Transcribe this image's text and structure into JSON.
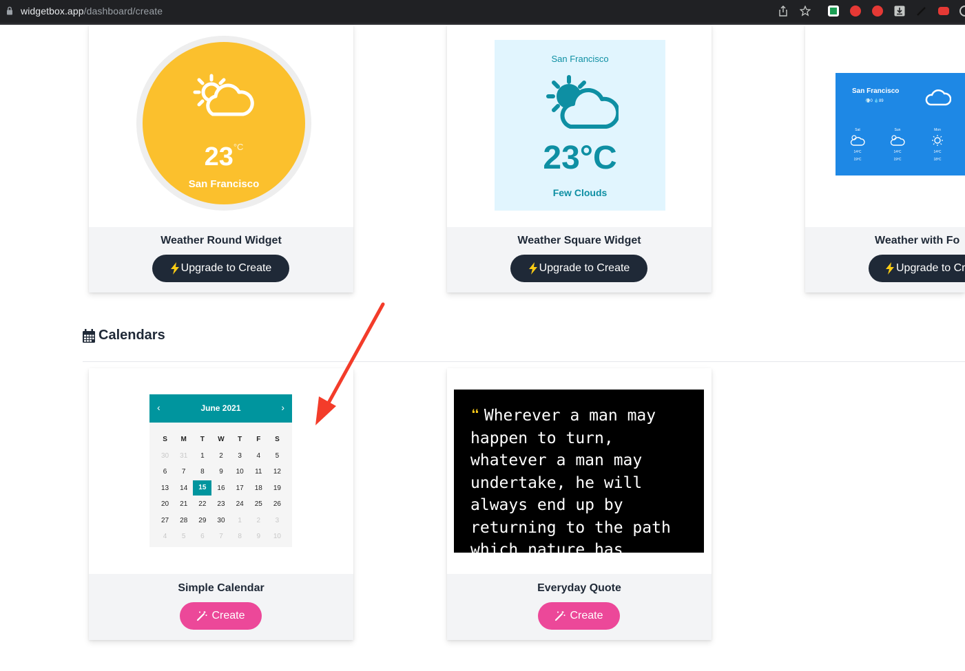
{
  "browser": {
    "url_host": "widgetbox.app",
    "url_path": "/dashboard/create"
  },
  "widgets_weather": [
    {
      "title": "Weather Round Widget",
      "button": "Upgrade to Create",
      "preview": {
        "temp": "23",
        "unit": "°C",
        "city": "San Francisco"
      }
    },
    {
      "title": "Weather Square Widget",
      "button": "Upgrade to Create",
      "preview": {
        "city": "San Francisco",
        "temp": "23°C",
        "desc": "Few Clouds"
      }
    },
    {
      "title": "Weather with Fo",
      "button": "Upgrade to Cr",
      "preview": {
        "city": "San Francisco",
        "sub": "💨0 💧89",
        "days": [
          {
            "d": "Sat",
            "t1": "14ºC",
            "t2": "19ºC"
          },
          {
            "d": "Sun",
            "t1": "14ºC",
            "t2": "19ºC"
          },
          {
            "d": "Mon",
            "t1": "14ºC",
            "t2": "18ºC"
          }
        ]
      }
    }
  ],
  "section": {
    "title": "Calendars"
  },
  "widgets_calendar": [
    {
      "title": "Simple Calendar",
      "button": "Create",
      "preview": {
        "month": "June 2021",
        "dow": [
          "S",
          "M",
          "T",
          "W",
          "T",
          "F",
          "S"
        ],
        "weeks": [
          [
            "30",
            "31",
            "1",
            "2",
            "3",
            "4",
            "5"
          ],
          [
            "6",
            "7",
            "8",
            "9",
            "10",
            "11",
            "12"
          ],
          [
            "13",
            "14",
            "15",
            "16",
            "17",
            "18",
            "19"
          ],
          [
            "20",
            "21",
            "22",
            "23",
            "24",
            "25",
            "26"
          ],
          [
            "27",
            "28",
            "29",
            "30",
            "1",
            "2",
            "3"
          ],
          [
            "4",
            "5",
            "6",
            "7",
            "8",
            "9",
            "10"
          ]
        ],
        "today": "15"
      }
    },
    {
      "title": "Everyday Quote",
      "button": "Create",
      "preview": {
        "quote_mark": "❝",
        "lines": [
          "Wherever a man may",
          "happen to turn,",
          "whatever a man may",
          "undertake, he will",
          "always end up by",
          "returning to the path",
          "which nature has"
        ]
      }
    }
  ],
  "colors": {
    "dark_button": "#1f2937",
    "pink_button": "#ec4899",
    "round_yellow": "#fbc02d",
    "teal": "#00959e",
    "forecast_blue": "#1e88e5",
    "arrow_red": "#f33c2a"
  }
}
